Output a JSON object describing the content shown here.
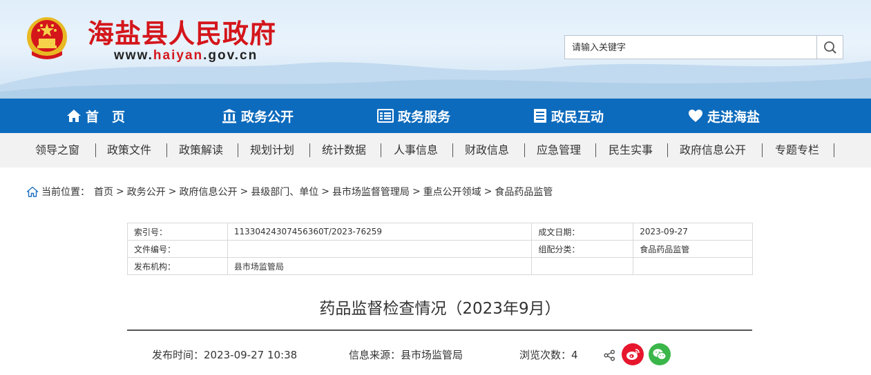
{
  "header": {
    "site_title": "海盐县人民政府",
    "url_prefix": "www.",
    "url_highlight": "haiyan",
    "url_suffix": ".gov.cn",
    "search_placeholder": "请输入关键字",
    "brand_red": "#d4161b"
  },
  "main_nav": [
    {
      "label": "首　页",
      "icon": "home-icon"
    },
    {
      "label": "政务公开",
      "icon": "building-icon"
    },
    {
      "label": "政务服务",
      "icon": "list-icon"
    },
    {
      "label": "政民互动",
      "icon": "document-icon"
    },
    {
      "label": "走进海盐",
      "icon": "heart-icon"
    }
  ],
  "sub_nav": [
    "领导之窗",
    "政策文件",
    "政策解读",
    "规划计划",
    "统计数据",
    "人事信息",
    "财政信息",
    "应急管理",
    "民生实事",
    "政府信息公开",
    "专题专栏"
  ],
  "breadcrumb": {
    "label": "当前位置：",
    "items": [
      "首页",
      "政务公开",
      "政府信息公开",
      "县级部门、单位",
      "县市场监督管理局",
      "重点公开领域",
      "食品药品监管"
    ],
    "separator": ">"
  },
  "meta_table": {
    "index_label": "索引号：",
    "index_value": "11330424307456360T/2023-76259",
    "date_label": "成文日期：",
    "date_value": "2023-09-27",
    "docno_label": "文件编号：",
    "docno_value": "",
    "category_label": "组配分类：",
    "category_value": "食品药品监管",
    "publisher_label": "发布机构：",
    "publisher_value": "县市场监管局"
  },
  "article": {
    "title": "药品监督检查情况（2023年9月）",
    "publish_time": "发布时间：2023-09-27 10:38",
    "source": "信息来源：县市场监管局",
    "views_label": "浏览次数：",
    "views": "4"
  },
  "colors": {
    "nav_blue": "#0d6bbd",
    "weibo_red": "#e6162d",
    "wechat_green": "#3bb64a"
  }
}
